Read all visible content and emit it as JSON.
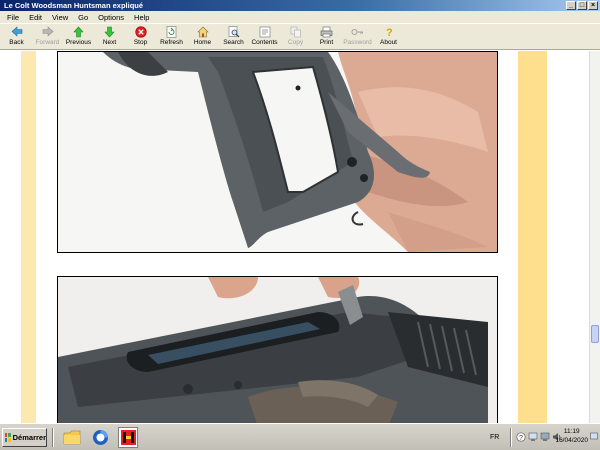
{
  "window": {
    "title": "Le Colt Woodsman Huntsman expliqué"
  },
  "menu": [
    "File",
    "Edit",
    "View",
    "Go",
    "Options",
    "Help"
  ],
  "toolbar": [
    {
      "label": "Back",
      "icon": "back-arrow-icon",
      "enabled": true
    },
    {
      "label": "Forward",
      "icon": "forward-arrow-icon",
      "enabled": false
    },
    {
      "label": "Previous",
      "icon": "up-arrow-icon",
      "enabled": true
    },
    {
      "label": "Next",
      "icon": "down-arrow-icon",
      "enabled": true
    },
    {
      "label": "Stop",
      "icon": "stop-icon",
      "enabled": true
    },
    {
      "label": "Refresh",
      "icon": "refresh-icon",
      "enabled": true
    },
    {
      "label": "Home",
      "icon": "home-icon",
      "enabled": true
    },
    {
      "label": "Search",
      "icon": "search-icon",
      "enabled": true
    },
    {
      "label": "Contents",
      "icon": "contents-icon",
      "enabled": true
    },
    {
      "label": "Copy",
      "icon": "copy-icon",
      "enabled": false
    },
    {
      "label": "Print",
      "icon": "print-icon",
      "enabled": true
    },
    {
      "label": "Password",
      "icon": "key-icon",
      "enabled": false
    },
    {
      "label": "About",
      "icon": "about-icon",
      "enabled": true
    }
  ],
  "content": {
    "photos": [
      {
        "subject": "pistol-frame-in-hand",
        "name": "photo-frame-held"
      },
      {
        "subject": "pistol-slide-close-up",
        "name": "photo-slide-closeup"
      }
    ],
    "band_left_color": "#fde9b0",
    "band_right_color": "#fddf8e"
  },
  "taskbar": {
    "start_label": "Démarrer",
    "language": "FR",
    "time": "11:19",
    "date": "16/04/2020"
  }
}
